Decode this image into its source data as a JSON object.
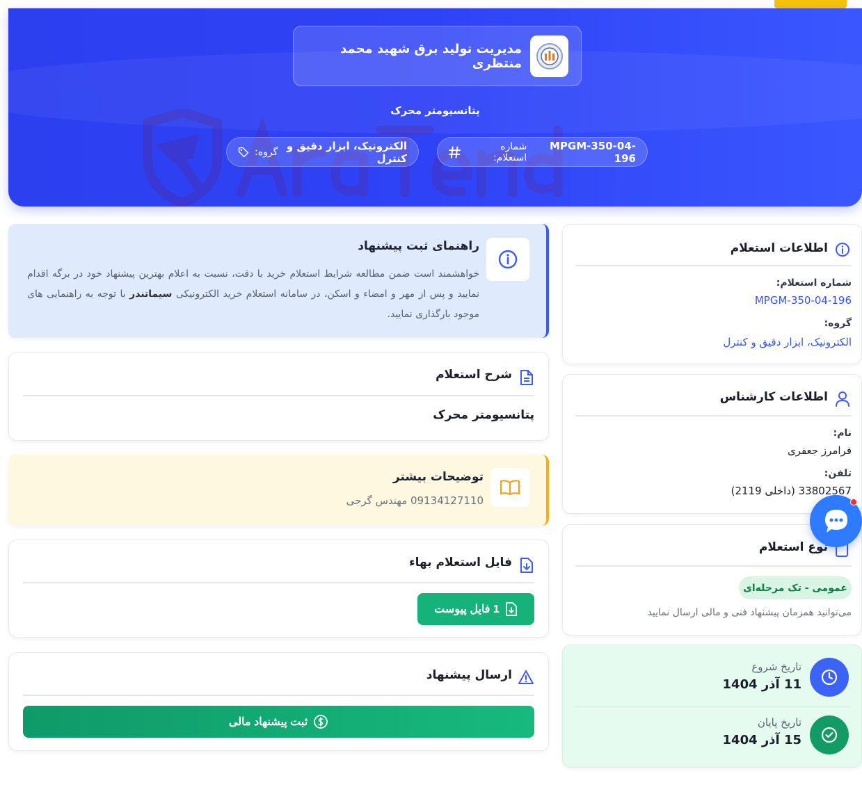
{
  "header": {
    "org_name": "مدیریت تولید برق شهید محمد منتظری",
    "subject": "پتانسیومتر محرک",
    "inquiry_number_label": "شماره استعلام:",
    "inquiry_number": "MPGM-350-04-196",
    "group_label": "گروه:",
    "group_value": "الکترونیک، ابزار دقیق و کنترل"
  },
  "guide": {
    "title": "راهنمای ثبت پیشنهاد",
    "text_before": "خواهشمند است ضمن مطالعه شرایط استعلام خرید با دقت، نسبت به اعلام بهترین پیشنهاد خود در برگه اقدام نمایید و پس از مهر و امضاء و اسکن، در سامانه استعلام خرید الکترونیکی ",
    "text_bold": "سیماتندر",
    "text_after": " با توجه به راهنمایی های موجود بارگذاری نمایید."
  },
  "description": {
    "title": "شرح استعلام",
    "value": "پتانسیومتر محرک"
  },
  "more": {
    "title": "توضیحات بیشتر",
    "text": "09134127110 مهندس گرجی"
  },
  "file": {
    "title": "فایل استعلام بهاء",
    "button": "1 فایل پیوست"
  },
  "submit": {
    "title": "ارسال پیشنهاد",
    "button": "ثبت پیشنهاد مالی"
  },
  "info": {
    "title": "اطلاعات استعلام",
    "number_label": "شماره استعلام:",
    "number_value": "MPGM-350-04-196",
    "group_label": "گروه:",
    "group_value": "الکترونیک، ابزار دقیق و کنترل"
  },
  "expert": {
    "title": "اطلاعات کارشناس",
    "name_label": "نام:",
    "name_value": "فرامرز جعفری",
    "phone_label": "تلفن:",
    "phone_value": "33802567 (داخلی 2119)"
  },
  "type": {
    "title": "نوع استعلام",
    "badge": "عمومی - تک مرحله‌ای",
    "note": "می‌توانید همزمان پیشنهاد فنی و مالی ارسال نمایید"
  },
  "dates": {
    "start_label": "تاریخ شروع",
    "start_value": "11 آذر 1404",
    "end_label": "تاریخ پایان",
    "end_value": "15 آذر 1404"
  },
  "colors": {
    "primary": "#2f43f6",
    "green": "#15b37a",
    "amber": "#f5b016",
    "link": "#3456e8"
  }
}
